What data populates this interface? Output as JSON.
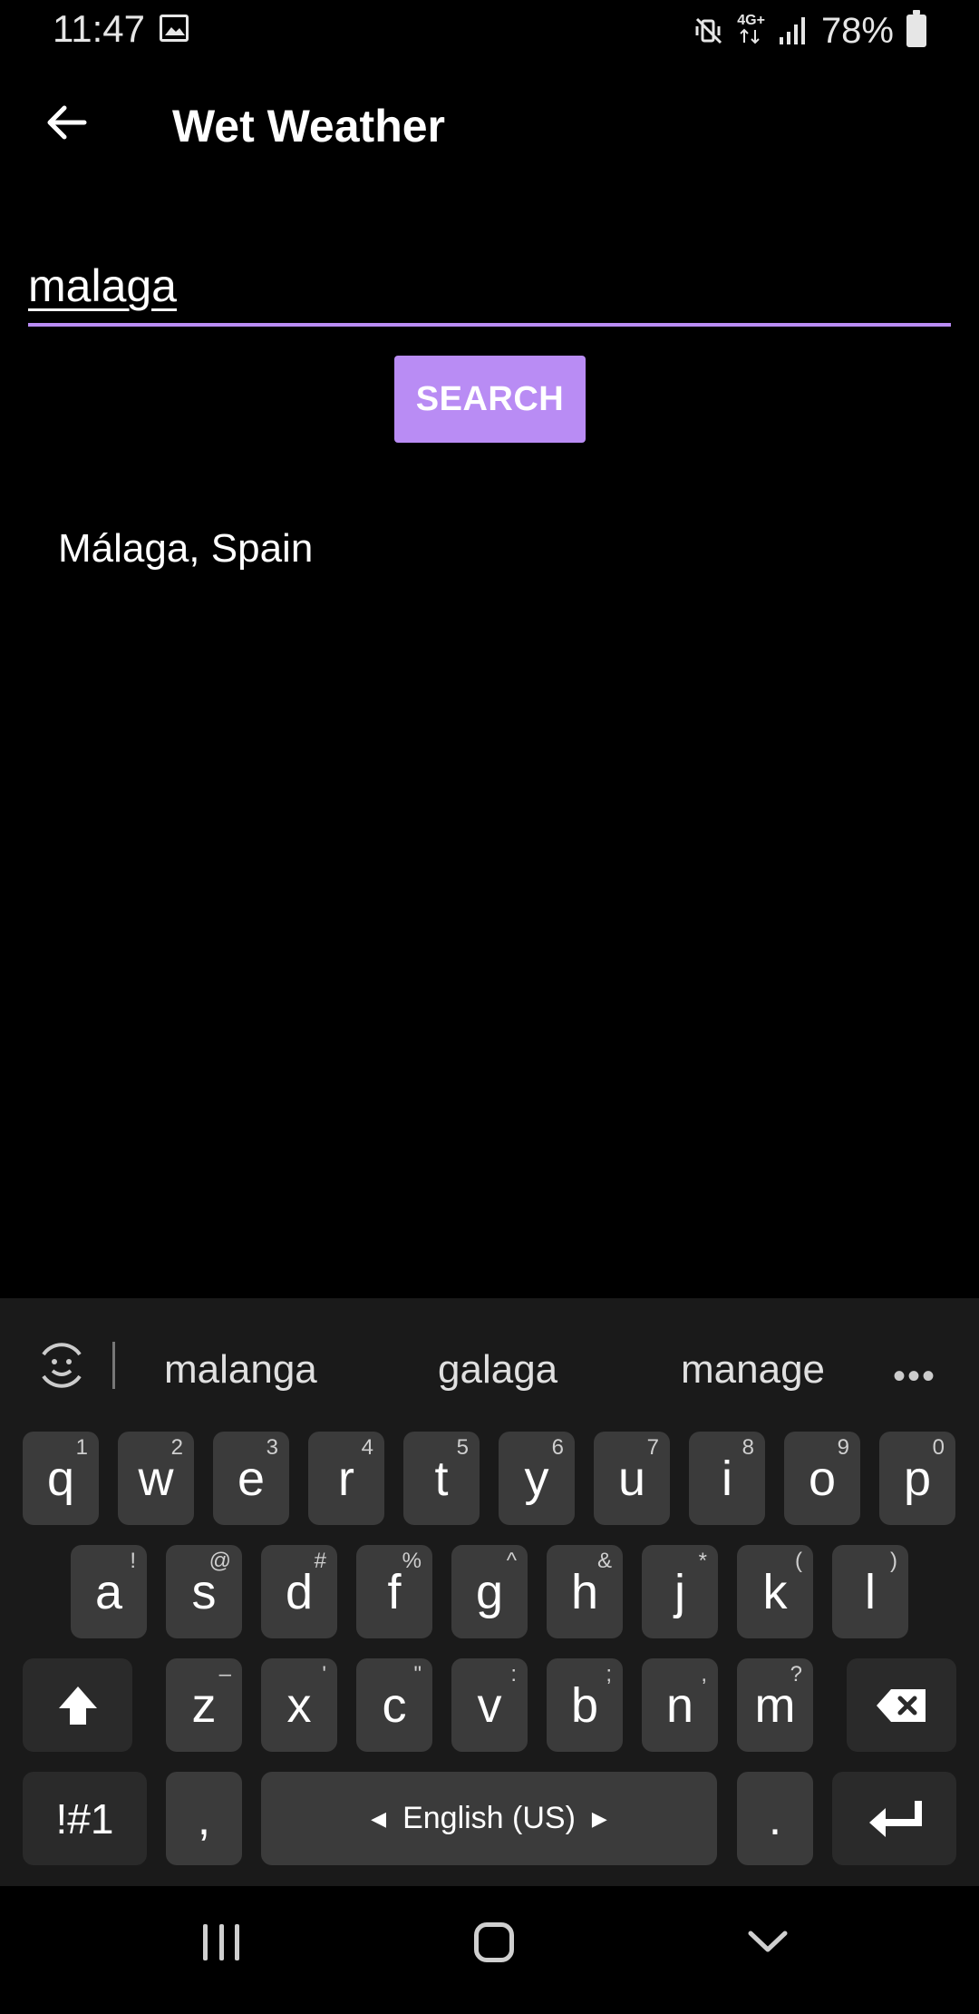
{
  "status_bar": {
    "time": "11:47",
    "battery": "78%",
    "network": "4G+"
  },
  "app_bar": {
    "title": "Wet Weather"
  },
  "search": {
    "value": "malaga",
    "button_label": "SEARCH"
  },
  "results": [
    "Málaga, Spain"
  ],
  "keyboard": {
    "suggestions": [
      "malanga",
      "galaga",
      "manage"
    ],
    "row1": [
      {
        "key": "q",
        "hint": "1"
      },
      {
        "key": "w",
        "hint": "2"
      },
      {
        "key": "e",
        "hint": "3"
      },
      {
        "key": "r",
        "hint": "4"
      },
      {
        "key": "t",
        "hint": "5"
      },
      {
        "key": "y",
        "hint": "6"
      },
      {
        "key": "u",
        "hint": "7"
      },
      {
        "key": "i",
        "hint": "8"
      },
      {
        "key": "o",
        "hint": "9"
      },
      {
        "key": "p",
        "hint": "0"
      }
    ],
    "row2": [
      {
        "key": "a",
        "hint": "!"
      },
      {
        "key": "s",
        "hint": "@"
      },
      {
        "key": "d",
        "hint": "#"
      },
      {
        "key": "f",
        "hint": "%"
      },
      {
        "key": "g",
        "hint": "^"
      },
      {
        "key": "h",
        "hint": "&"
      },
      {
        "key": "j",
        "hint": "*"
      },
      {
        "key": "k",
        "hint": "("
      },
      {
        "key": "l",
        "hint": ")"
      }
    ],
    "row3": [
      {
        "key": "z",
        "hint": "–"
      },
      {
        "key": "x",
        "hint": "'"
      },
      {
        "key": "c",
        "hint": "\""
      },
      {
        "key": "v",
        "hint": ":"
      },
      {
        "key": "b",
        "hint": ";"
      },
      {
        "key": "n",
        "hint": ","
      },
      {
        "key": "m",
        "hint": "?"
      }
    ],
    "symbols_label": "!#1",
    "comma_label": ",",
    "space_label": "English (US)",
    "period_label": "."
  },
  "colors": {
    "accent": "#b98cf4",
    "background": "#000000",
    "keyboard_bg": "#1a1a1a",
    "key_bg": "#3b3b3b"
  }
}
